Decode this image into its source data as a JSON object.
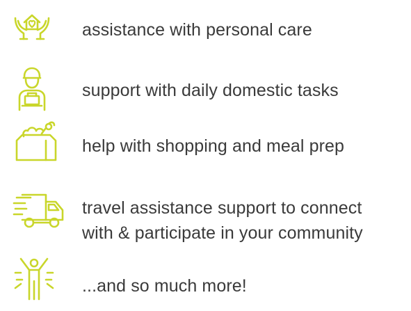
{
  "accent_color": "#c9d62a",
  "services": [
    {
      "icon": "caring-hands-house-icon",
      "label": "assistance with personal care"
    },
    {
      "icon": "carer-person-icon",
      "label": "support with daily domestic tasks"
    },
    {
      "icon": "grocery-bag-icon",
      "label": "help with shopping and meal prep"
    },
    {
      "icon": "delivery-truck-icon",
      "label_line1": "travel assistance support to connect",
      "label_line2": "with & participate in your community"
    },
    {
      "icon": "celebrating-person-icon",
      "label": "...and so much more!"
    }
  ]
}
